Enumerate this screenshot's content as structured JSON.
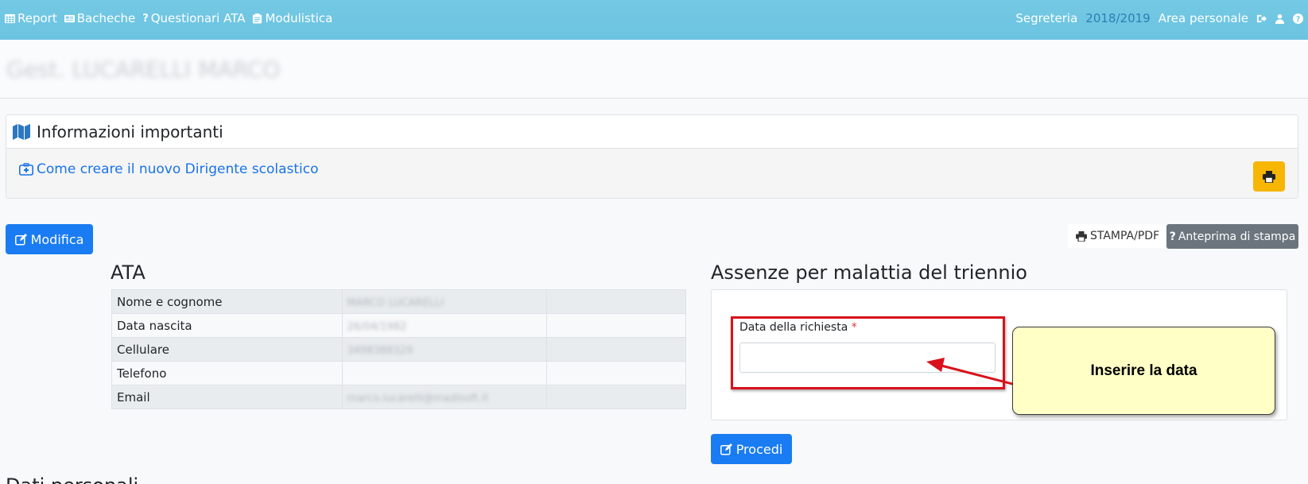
{
  "nav": {
    "left": [
      {
        "label": "Report",
        "icon": "table-icon"
      },
      {
        "label": "Bacheche",
        "icon": "newspaper-icon"
      },
      {
        "label": "Questionari ATA",
        "icon": "question-icon"
      },
      {
        "label": "Modulistica",
        "icon": "clipboard-icon"
      }
    ],
    "segreteria": "Segreteria",
    "year": "2018/2019",
    "area_personale": "Area personale"
  },
  "page": {
    "blurred_title": "Gest. LUCARELLI MARCO"
  },
  "info": {
    "heading": "Informazioni importanti",
    "link": "Come creare il nuovo Dirigente scolastico"
  },
  "actions": {
    "modifica": "Modifica",
    "stampa": "STAMPA/PDF",
    "anteprima": "Anteprima di stampa",
    "procedi": "Procedi"
  },
  "ata": {
    "title": "ATA",
    "rows": [
      {
        "label": "Nome e cognome",
        "value": "MARCO LUCARELLI"
      },
      {
        "label": "Data nascita",
        "value": "26/04/1982"
      },
      {
        "label": "Cellulare",
        "value": "3498388329"
      },
      {
        "label": "Telefono",
        "value": ""
      },
      {
        "label": "Email",
        "value": "marco.lucarelli@madisoft.it"
      }
    ]
  },
  "assenze": {
    "title": "Assenze per malattia del triennio",
    "field_label": "Data della richiesta",
    "required_mark": "*",
    "input_value": ""
  },
  "annotation": {
    "callout_text": "Inserire la data",
    "box_color": "#d9111b"
  },
  "next_section": "Dati personali",
  "colors": {
    "topbar": "#6cc3e0",
    "primary": "#1a7cf2",
    "warning": "#f7b602",
    "secondary": "#6c757d",
    "callout": "#ffffc6"
  }
}
